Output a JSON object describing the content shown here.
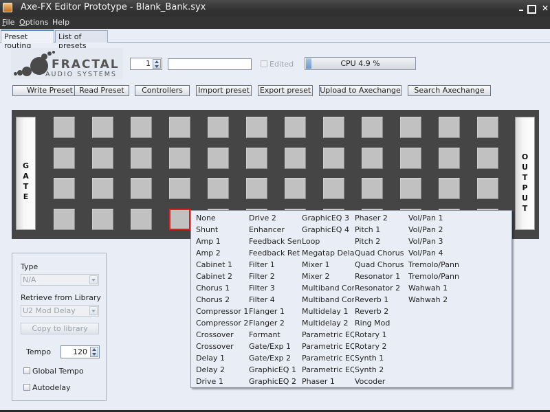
{
  "window": {
    "title": "Axe-FX Editor Prototype - Blank_Bank.syx",
    "controls": [
      "minimize",
      "maximize",
      "close"
    ]
  },
  "menu": [
    {
      "label": "File",
      "mnemonic": "F",
      "rest": "ile"
    },
    {
      "label": "Options",
      "mnemonic": "O",
      "rest": "ptions"
    },
    {
      "label": "Help",
      "mnemonic": "",
      "rest": "Help"
    }
  ],
  "tabs": [
    {
      "label": "Preset routing",
      "active": true
    },
    {
      "label": "List of presets",
      "active": false
    }
  ],
  "logo": {
    "line1": "FRACTAL",
    "line2": "AUDIO SYSTEMS"
  },
  "preset": {
    "number": "1",
    "name": "",
    "edited_label": "Edited",
    "edited_checked": false
  },
  "cpu": {
    "label": "CPU 4.9 %",
    "percent": 4.9
  },
  "toolbar": [
    "Write Preset",
    "Read Preset",
    "Controllers",
    "Import preset",
    "Export preset",
    "Upload to Axechange",
    "Search Axechange"
  ],
  "routing": {
    "input_label": "GATE",
    "output_label": "OUTPUT",
    "rows": 4,
    "columns": 12,
    "selected_cell": {
      "row": 4,
      "column": 4
    }
  },
  "block_menu": {
    "columns": [
      [
        "None",
        "Shunt",
        "Amp 1",
        "Amp 2",
        "Cabinet 1",
        "Cabinet 2",
        "Chorus 1",
        "Chorus 2",
        "Compressor 1",
        "Compressor 2",
        "Crossover",
        "Crossover",
        "Delay 1",
        "Delay 2",
        "Drive 1"
      ],
      [
        "Drive 2",
        "Enhancer",
        "Feedback Sen",
        "Feedback Ret",
        "Filter 1",
        "Filter 2",
        "Filter 3",
        "Filter 4",
        "Flanger 1",
        "Flanger 2",
        "Formant",
        "Gate/Exp 1",
        "Gate/Exp 2",
        "GraphicEQ 1",
        "GraphicEQ 2"
      ],
      [
        "GraphicEQ 3",
        "GraphicEQ 4",
        "Loop",
        "Megatap Delay",
        "Mixer 1",
        "Mixer 2",
        "Multiband Con",
        "Multiband Con",
        "Multidelay 1",
        "Multidelay 2",
        "Parametric EQ",
        "Parametric EQ",
        "Parametric EQ",
        "Parametric EQ",
        "Phaser 1"
      ],
      [
        "Phaser 2",
        "Pitch 1",
        "Pitch 2",
        "Quad Chorus",
        "Quad Chorus",
        "Resonator 1",
        "Resonator 2",
        "Reverb 1",
        "Reverb 2",
        "Ring Mod",
        "Rotary 1",
        "Rotary 2",
        "Synth 1",
        "Synth 2",
        "Vocoder"
      ],
      [
        "Vol/Pan 1",
        "Vol/Pan 2",
        "Vol/Pan 3",
        "Vol/Pan 4",
        "Tremolo/Pann",
        "Tremolo/Pann",
        "Wahwah 1",
        "Wahwah 2"
      ]
    ]
  },
  "block_panel": {
    "type_label": "Type",
    "type_value": "N/A",
    "library_label": "Retrieve from Library",
    "library_value": "U2 Mod Delay",
    "copy_button": "Copy to library",
    "tempo_label": "Tempo",
    "tempo_value": "120",
    "global_tempo_label": "Global Tempo",
    "global_tempo_checked": false,
    "autodelay_label": "Autodelay",
    "autodelay_checked": false
  },
  "colors": {
    "accent": "#5b86c4",
    "selected_cell": "#e21d1d",
    "routing_bg": "#454545",
    "cell": "#c1c1c1"
  }
}
